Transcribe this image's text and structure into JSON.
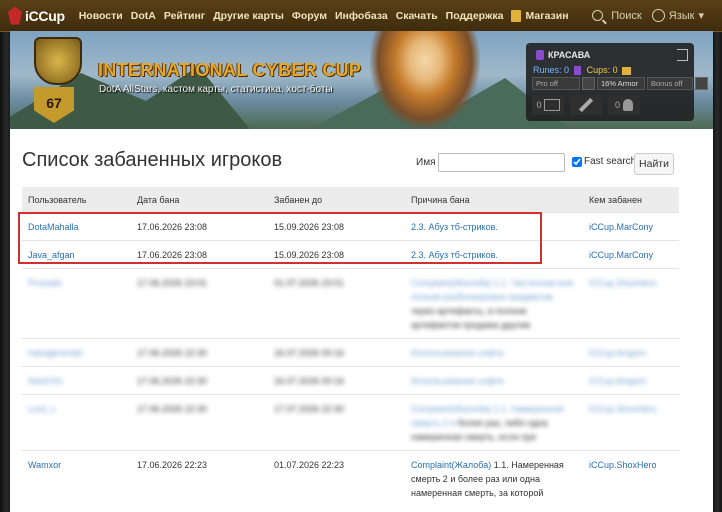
{
  "nav": {
    "logo": "iCCup",
    "items": [
      "Новости",
      "DotA",
      "Рейтинг",
      "Другие карты",
      "Форум",
      "Инфобаза",
      "Скачать",
      "Поддержка"
    ],
    "shop": "Магазин",
    "search": "Поиск",
    "language": "Язык"
  },
  "banner": {
    "title": "INTERNATIONAL CYBER CUP",
    "subtitle": "DotA AllStars, кастом карты, статистика, хост-боты",
    "level": "67"
  },
  "user": {
    "name": "КРАСАВА",
    "runes_label": "Runes:",
    "runes": "0",
    "cups_label": "Cups:",
    "cups": "0",
    "pro": "Pro off",
    "armor": "16% Armor",
    "bonus": "Bonus off",
    "messages": "0",
    "other": "0"
  },
  "page": {
    "title": "Список забаненных игроков",
    "search_label": "Имя",
    "fast_search": "Fast search",
    "find_button": "Найти"
  },
  "table": {
    "headers": [
      "Пользователь",
      "Дата бана",
      "Забанен до",
      "Причина бана",
      "Кем забанен"
    ],
    "rows": [
      {
        "user": "DotaMahalla",
        "date": "17.06.2026 23:08",
        "until": "15.09.2026 23:08",
        "reason_link": "2.3. Абуз тб-стриков.",
        "reason_text": "",
        "by": "iCCup.MarCony"
      },
      {
        "user": "Java_afgan",
        "date": "17.06.2026 23:08",
        "until": "15.09.2026 23:08",
        "reason_link": "2.3. Абуз тб-стриков.",
        "reason_text": "",
        "by": "iCCup.MarCony"
      },
      {
        "user": "Protoabi",
        "date": "17.06.2026 23:01",
        "until": "01.07.2026 23:01",
        "reason_link": "Complaint(Жалоба) 1.1. Частичная или полная разблокировка предметов",
        "reason_text": "через артефакты, в полном артефактов продажа другим",
        "by": "iCCup.ShoxHero"
      },
      {
        "user": "habagkrendel",
        "date": "17.06.2026 22:30",
        "until": "16.07.2026 00:16",
        "reason_link": "Использование софта",
        "reason_text": "",
        "by": "iCCup.bingorn"
      },
      {
        "user": "NashVtn",
        "date": "17.06.2026 22:30",
        "until": "16.07.2026 00:16",
        "reason_link": "Использование софта",
        "reason_text": "",
        "by": "iCCup.bingorn"
      },
      {
        "user": "Lord_s",
        "date": "17.06.2026 22:30",
        "until": "17.07.2026 22:30",
        "reason_link": "Complaint(Жалоба) 1.1. Намеренная смерть 2 и",
        "reason_text": "более раз, либо одна намеренная смерть, если при",
        "by": "iCCup.ShoxHero"
      },
      {
        "user": "Wamxor",
        "date": "17.06.2026 22:23",
        "until": "01.07.2026 22:23",
        "reason_link": "Complaint(Жалоба)",
        "reason_text": " 1.1. Намеренная смерть 2 и более раз или одна намеренная смерть, за которой",
        "by": "iCCup.ShoxHero"
      }
    ]
  },
  "colors": {
    "nav_bg": "#4d3612",
    "link": "#2a6fb5",
    "highlight": "#d32f2f",
    "banner_title": "#e3a82a"
  }
}
